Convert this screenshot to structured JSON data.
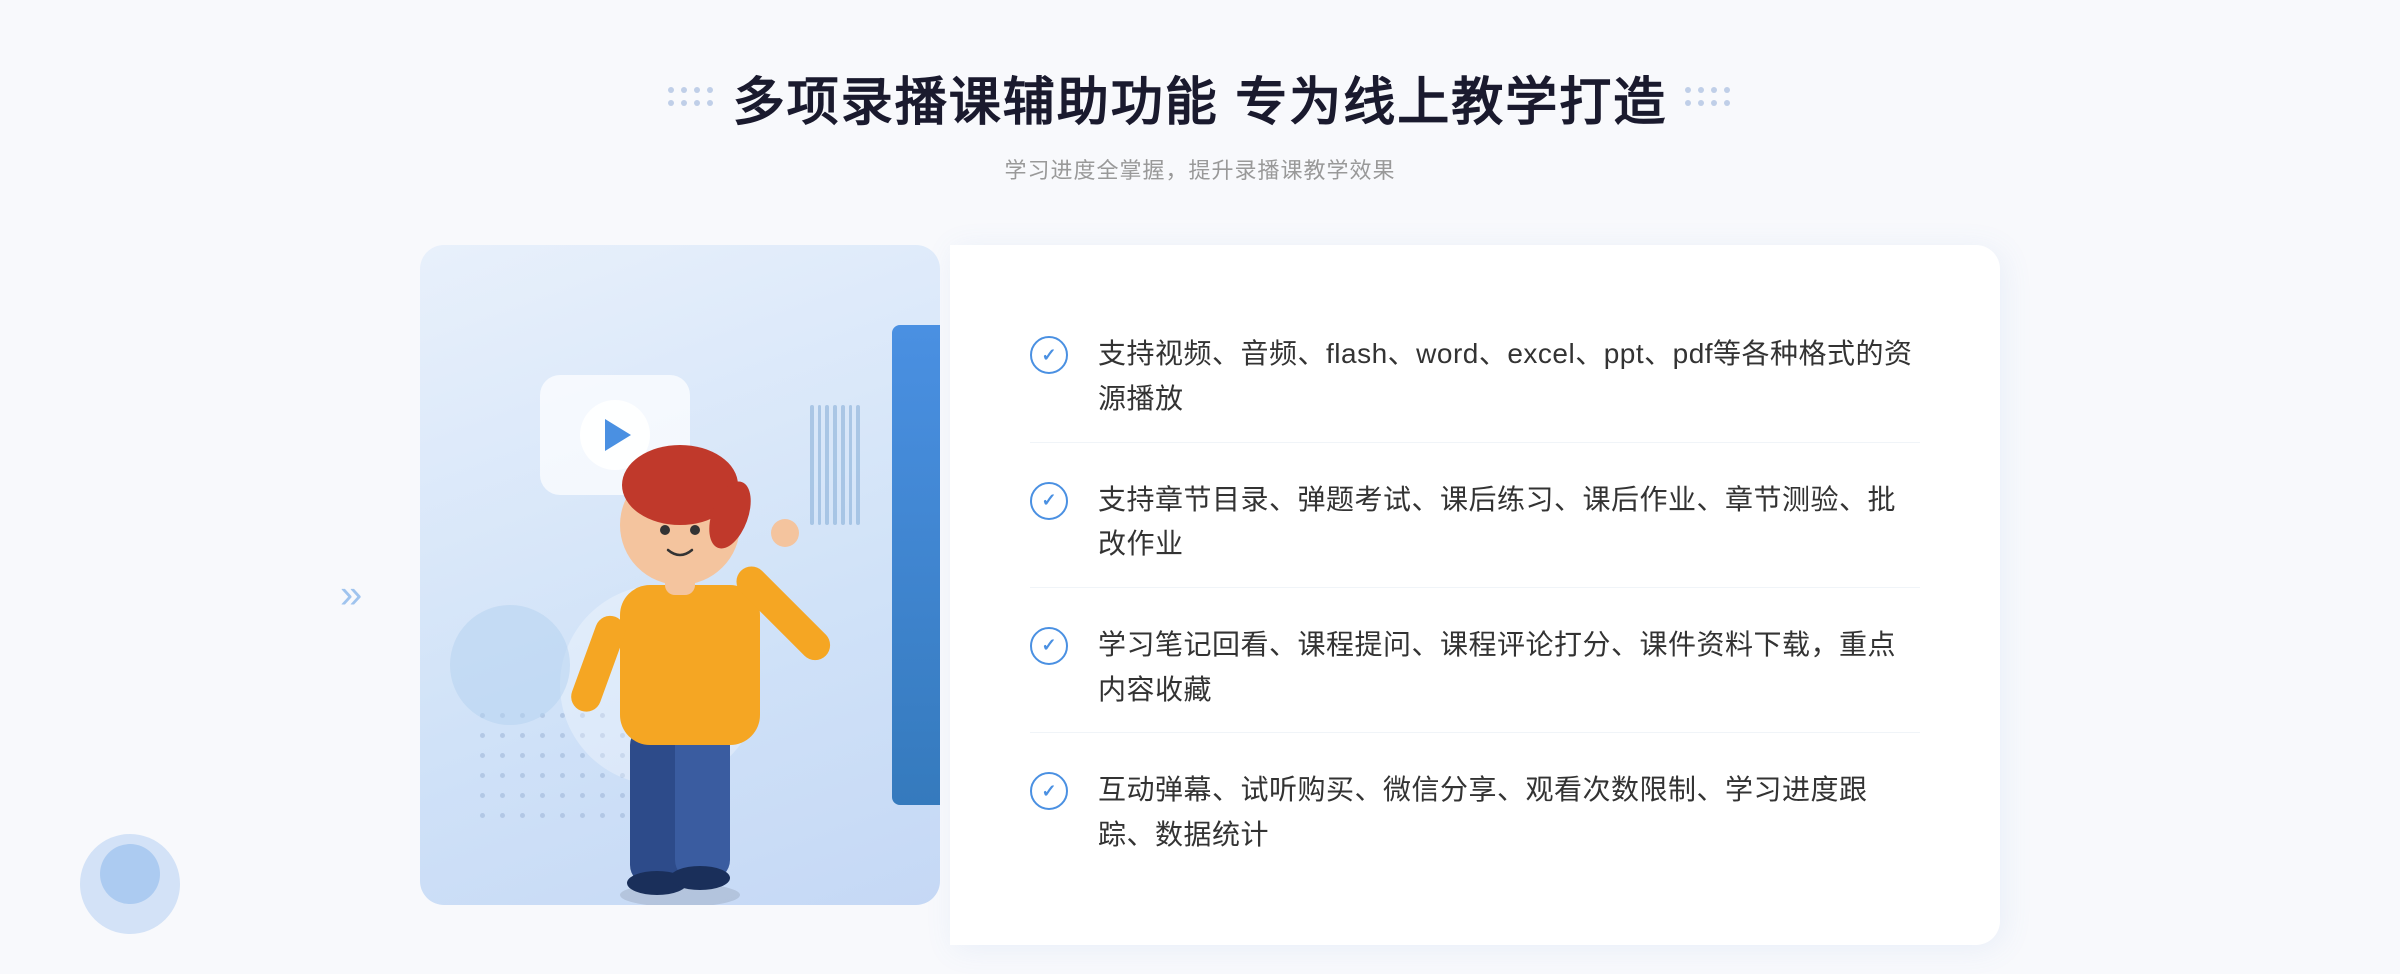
{
  "header": {
    "title": "多项录播课辅助功能 专为线上教学打造",
    "subtitle": "学习进度全掌握，提升录播课教学效果"
  },
  "features": [
    {
      "id": 1,
      "text": "支持视频、音频、flash、word、excel、ppt、pdf等各种格式的资源播放"
    },
    {
      "id": 2,
      "text": "支持章节目录、弹题考试、课后练习、课后作业、章节测验、批改作业"
    },
    {
      "id": 3,
      "text": "学习笔记回看、课程提问、课程评论打分、课件资料下载，重点内容收藏"
    },
    {
      "id": 4,
      "text": "互动弹幕、试听购买、微信分享、观看次数限制、学习进度跟踪、数据统计"
    }
  ],
  "decoration": {
    "chevrons": "»",
    "play_button_label": "play"
  }
}
